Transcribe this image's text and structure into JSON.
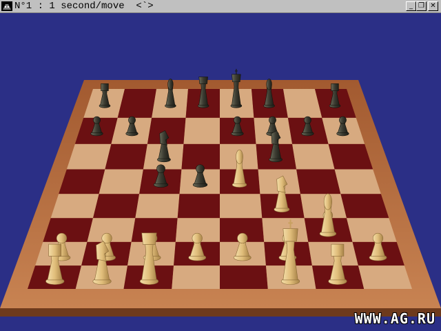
{
  "window": {
    "title": "N°1 : 1 second/move  <`>",
    "min_glyph": "_",
    "max_glyph": "❐",
    "close_glyph": "✕"
  },
  "board": {
    "light_square_color": "#d7aa80",
    "dark_square_color": "#6b1012",
    "frame_color": "#b26a3c",
    "background_color": "#2b2f86",
    "white_piece_color": "#e6c887",
    "black_piece_color": "#3a3a30"
  },
  "pieces": {
    "black": [
      {
        "type": "rook",
        "square": "a8"
      },
      {
        "type": "bishop",
        "square": "c8"
      },
      {
        "type": "queen",
        "square": "d8"
      },
      {
        "type": "king",
        "square": "e8"
      },
      {
        "type": "bishop",
        "square": "f8"
      },
      {
        "type": "rook",
        "square": "h8"
      },
      {
        "type": "pawn",
        "square": "a7"
      },
      {
        "type": "pawn",
        "square": "b7"
      },
      {
        "type": "knight",
        "square": "c6"
      },
      {
        "type": "pawn",
        "square": "e7"
      },
      {
        "type": "pawn",
        "square": "f7"
      },
      {
        "type": "knight",
        "square": "f6"
      },
      {
        "type": "pawn",
        "square": "g7"
      },
      {
        "type": "pawn",
        "square": "h7"
      },
      {
        "type": "pawn",
        "square": "c5"
      },
      {
        "type": "pawn",
        "square": "d5"
      }
    ],
    "white": [
      {
        "type": "bishop",
        "square": "e5"
      },
      {
        "type": "knight",
        "square": "f4"
      },
      {
        "type": "pawn",
        "square": "g3"
      },
      {
        "type": "bishop",
        "square": "g3"
      },
      {
        "type": "pawn",
        "square": "a2"
      },
      {
        "type": "pawn",
        "square": "b2"
      },
      {
        "type": "pawn",
        "square": "c2"
      },
      {
        "type": "pawn",
        "square": "d2"
      },
      {
        "type": "pawn",
        "square": "e2"
      },
      {
        "type": "pawn",
        "square": "f2"
      },
      {
        "type": "pawn",
        "square": "h2"
      },
      {
        "type": "rook",
        "square": "a1"
      },
      {
        "type": "knight",
        "square": "b1"
      },
      {
        "type": "queen",
        "square": "c1"
      },
      {
        "type": "king",
        "square": "f1"
      },
      {
        "type": "rook",
        "square": "g1"
      }
    ]
  },
  "watermark": "WWW.AG.RU"
}
